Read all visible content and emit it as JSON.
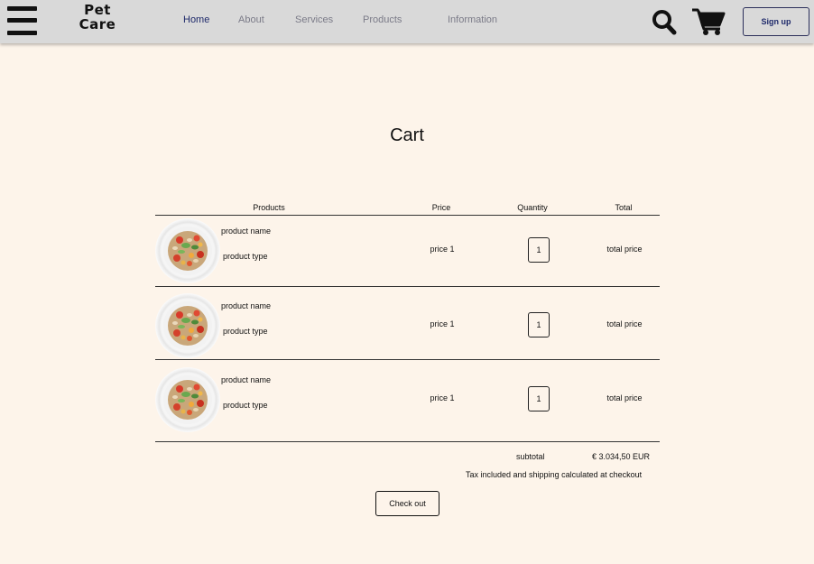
{
  "header": {
    "logo_line1": "Pet",
    "logo_line2": "Care",
    "nav": [
      {
        "label": "Home"
      },
      {
        "label": "About"
      },
      {
        "label": "Services"
      },
      {
        "label": "Products"
      },
      {
        "label": "Information"
      }
    ],
    "active_nav": "Home",
    "search_icon": "search-icon",
    "cart_icon": "cart-icon",
    "signup_label": "Sign up"
  },
  "colors": {
    "background": "#fdf4ea",
    "header_bg": "#d9d9d9",
    "nav_active": "#1f2a6b",
    "nav_inactive": "#7b7b88"
  },
  "cart": {
    "title": "Cart",
    "columns": {
      "products": "Products",
      "price": "Price",
      "quantity": "Quantity",
      "total": "Total"
    },
    "items": [
      {
        "name": "product name",
        "type": "product type",
        "price": "price 1",
        "quantity": "1",
        "total": "total price",
        "image": "pet-food-bowl-image"
      },
      {
        "name": "product name",
        "type": "product type",
        "price": "price 1",
        "quantity": "1",
        "total": "total price",
        "image": "pet-food-bowl-image"
      },
      {
        "name": "product name",
        "type": "product type",
        "price": "price 1",
        "quantity": "1",
        "total": "total price",
        "image": "pet-food-bowl-image"
      }
    ],
    "subtotal_label": "subtotal",
    "subtotal_value": "€ 3.034,50 EUR",
    "tax_note": "Tax included and shipping calculated at checkout",
    "checkout_label": "Check out"
  }
}
